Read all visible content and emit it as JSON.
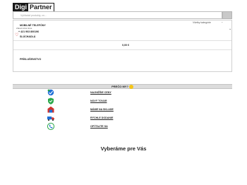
{
  "header": {
    "logo_left": "Digi",
    "logo_right": "Partner",
    "search_placeholder": "Vyhľadať produkty, zn..."
  },
  "panel": {
    "category_select": "Všetky kategórie",
    "menu_items": [
      {
        "label": "MOBILNÉ TELEFÓNY"
      },
      {
        "label": "SLÚCHADLÁ"
      },
      {
        "label": "PRÍSLUŠENSTVO"
      }
    ],
    "note_top": "Zákaznícka linka",
    "note_bottom": "",
    "phone": "+ 421 903 800196",
    "cart_total": "0,00 €"
  },
  "why_us": {
    "title": "PREČO MY?",
    "features": [
      {
        "label": "NAJNIŽŠIE CENY",
        "icon": "price-tag-icon"
      },
      {
        "label": "NOVÝ TOVAR",
        "icon": "shield-check-icon"
      },
      {
        "label": "MÁME NA SKLADE",
        "icon": "warehouse-icon"
      },
      {
        "label": "RÝCHLE DODANIE",
        "icon": "delivery-truck-icon"
      },
      {
        "label": "OPÝTAJTE SA",
        "icon": "support-phone-icon"
      }
    ]
  },
  "headline": "Vyberáme pre Vás",
  "colors": {
    "logo_dark": "#1a1a1a",
    "why_bar": "#dcdcdc",
    "accent_blue": "#1f6fd6",
    "accent_green": "#2aa84a",
    "accent_red": "#d0312d"
  }
}
